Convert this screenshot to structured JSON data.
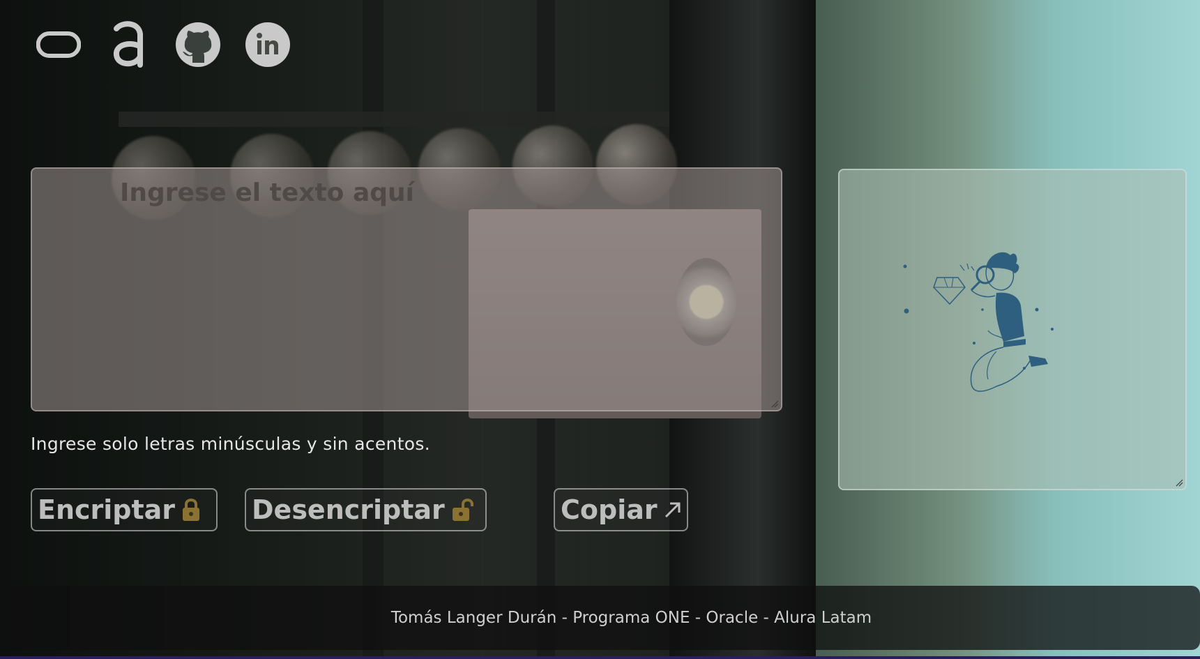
{
  "social_links": [
    {
      "name": "oracle-icon"
    },
    {
      "name": "alura-icon"
    },
    {
      "name": "github-icon"
    },
    {
      "name": "linkedin-icon"
    }
  ],
  "input": {
    "placeholder": "Ingrese el texto aquí",
    "value": ""
  },
  "hint": "Ingrese solo letras minúsculas y sin acentos.",
  "buttons": {
    "encrypt_label": "Encriptar",
    "decrypt_label": "Desencriptar",
    "copy_label": "Copiar",
    "encrypt_icon": "lock-closed-icon",
    "decrypt_icon": "lock-open-icon",
    "copy_icon": "arrow-up-right-icon"
  },
  "output": {
    "illustration": "person-with-magnifier-illustration"
  },
  "footer": {
    "credit": "Tomás Langer Durán - Programa ONE - Oracle - Alura Latam"
  },
  "colors": {
    "icon_gray": "#c9c9c9",
    "lock_gold": "#8a7232",
    "illustration_blue": "#2f5f7e"
  }
}
